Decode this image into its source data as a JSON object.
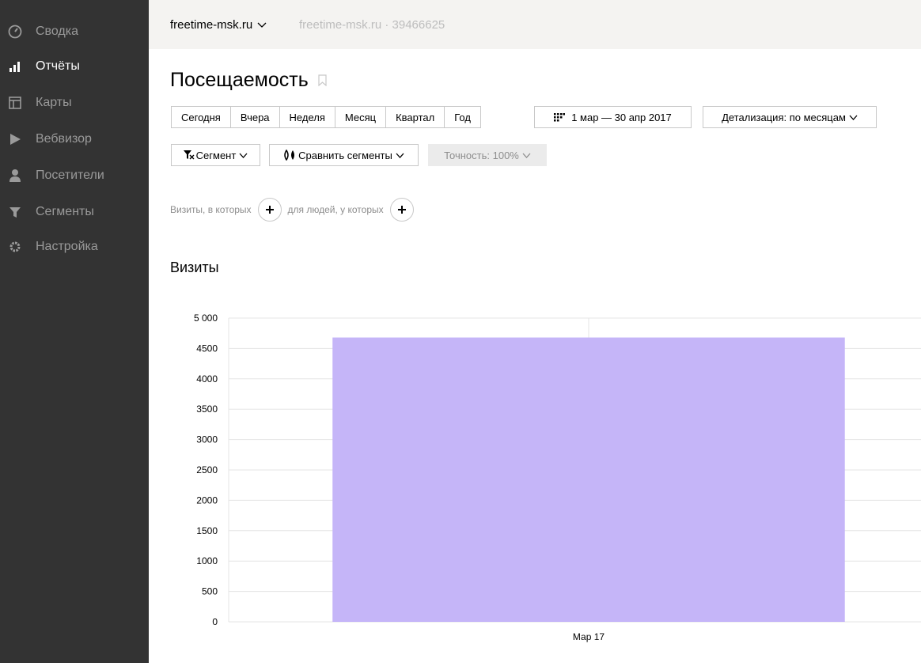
{
  "sidebar": {
    "items": [
      {
        "label": "Сводка",
        "icon": "dashboard-icon",
        "active": false
      },
      {
        "label": "Отчёты",
        "icon": "bar-chart-icon",
        "active": true
      },
      {
        "label": "Карты",
        "icon": "map-icon",
        "active": false
      },
      {
        "label": "Вебвизор",
        "icon": "play-icon",
        "active": false
      },
      {
        "label": "Посетители",
        "icon": "user-icon",
        "active": false
      },
      {
        "label": "Сегменты",
        "icon": "funnel-icon",
        "active": false
      },
      {
        "label": "Настройка",
        "icon": "gear-icon",
        "active": false
      }
    ]
  },
  "topbar": {
    "site": "freetime-msk.ru",
    "site_id": "freetime-msk.ru · 39466625"
  },
  "page": {
    "title": "Посещаемость"
  },
  "toolbar": {
    "periods": [
      "Сегодня",
      "Вчера",
      "Неделя",
      "Месяц",
      "Квартал",
      "Год"
    ],
    "date_range": "1 мар — 30 апр 2017",
    "detail": "Детализация: по месяцам",
    "segment": "Сегмент",
    "compare": "Сравнить сегменты",
    "accuracy": "Точность: 100%"
  },
  "filters": {
    "visits_label": "Визиты, в которых",
    "people_label": "для людей, у которых"
  },
  "section": {
    "title": "Визиты"
  },
  "chart_data": {
    "type": "bar",
    "categories": [
      "Мар 17"
    ],
    "values": [
      4680
    ],
    "yticks": [
      0,
      500,
      1000,
      1500,
      2000,
      2500,
      3000,
      3500,
      4000,
      4500,
      5000
    ],
    "ytick_labels": [
      "0",
      "500",
      "1000",
      "1500",
      "2000",
      "2500",
      "3000",
      "3500",
      "4000",
      "4500",
      "5 000"
    ],
    "ylim": [
      0,
      5000
    ],
    "grid": true,
    "color": "#c5b5f8"
  }
}
